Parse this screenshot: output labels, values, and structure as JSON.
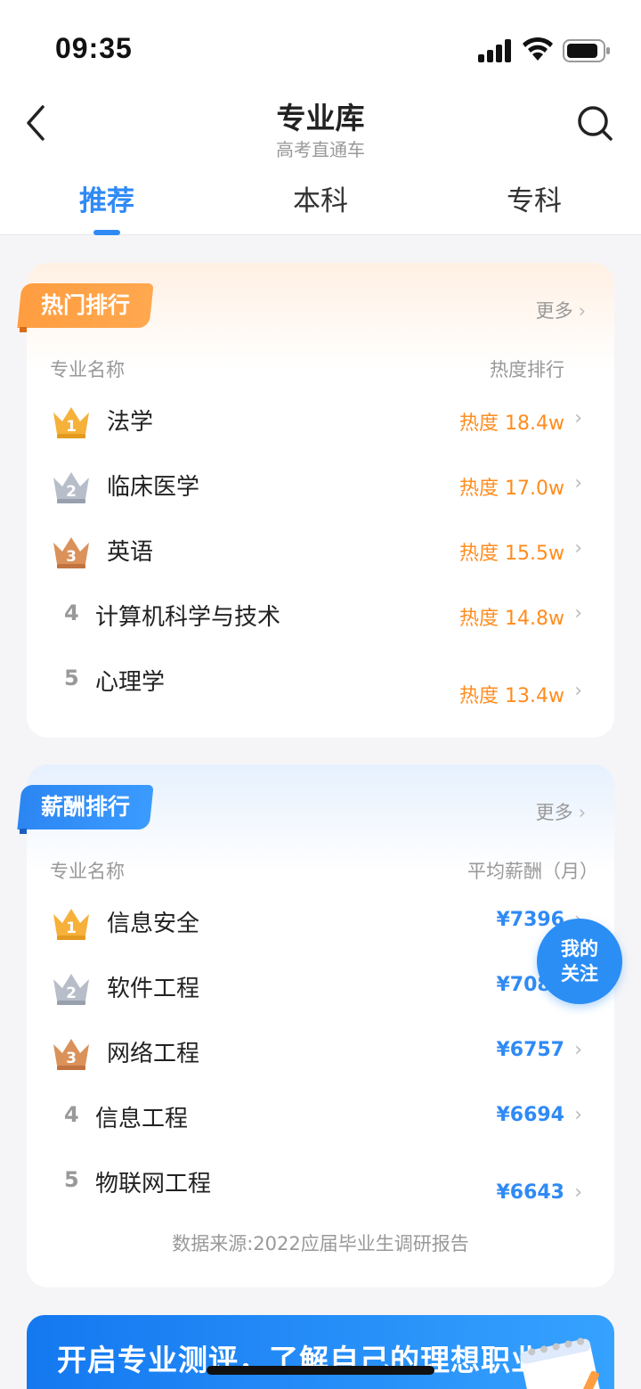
{
  "status_bar": {
    "time": "09:35"
  },
  "nav": {
    "title": "专业库",
    "subtitle": "高考直通车"
  },
  "tabs": [
    {
      "label": "推荐",
      "active": true
    },
    {
      "label": "本科",
      "active": false
    },
    {
      "label": "专科",
      "active": false
    }
  ],
  "hot_ranking": {
    "badge": "热门排行",
    "more": "更多",
    "col_left": "专业名称",
    "col_right": "热度排行",
    "items": [
      {
        "rank": "1",
        "name": "法学",
        "value": "热度 18.4w"
      },
      {
        "rank": "2",
        "name": "临床医学",
        "value": "热度 17.0w"
      },
      {
        "rank": "3",
        "name": "英语",
        "value": "热度 15.5w"
      },
      {
        "rank": "4",
        "name": "计算机科学与技术",
        "value": "热度 14.8w"
      },
      {
        "rank": "5",
        "name": "心理学",
        "value": "热度 13.4w"
      }
    ]
  },
  "salary_ranking": {
    "badge": "薪酬排行",
    "more": "更多",
    "col_left": "专业名称",
    "col_right": "平均薪酬（月）",
    "items": [
      {
        "rank": "1",
        "name": "信息安全",
        "value": "¥7396"
      },
      {
        "rank": "2",
        "name": "软件工程",
        "value": "¥7082"
      },
      {
        "rank": "3",
        "name": "网络工程",
        "value": "¥6757"
      },
      {
        "rank": "4",
        "name": "信息工程",
        "value": "¥6694"
      },
      {
        "rank": "5",
        "name": "物联网工程",
        "value": "¥6643"
      }
    ],
    "source": "数据来源:2022应届毕业生调研报告"
  },
  "fab": {
    "line1": "我的",
    "line2": "关注"
  },
  "banner": {
    "text": "开启专业测评，了解自己的理想职业"
  },
  "colors": {
    "accent": "#2f8af5",
    "hot": "#ff8c1f",
    "gold": "#f6b13a",
    "silver": "#aab2c0",
    "bronze": "#d98a52"
  }
}
